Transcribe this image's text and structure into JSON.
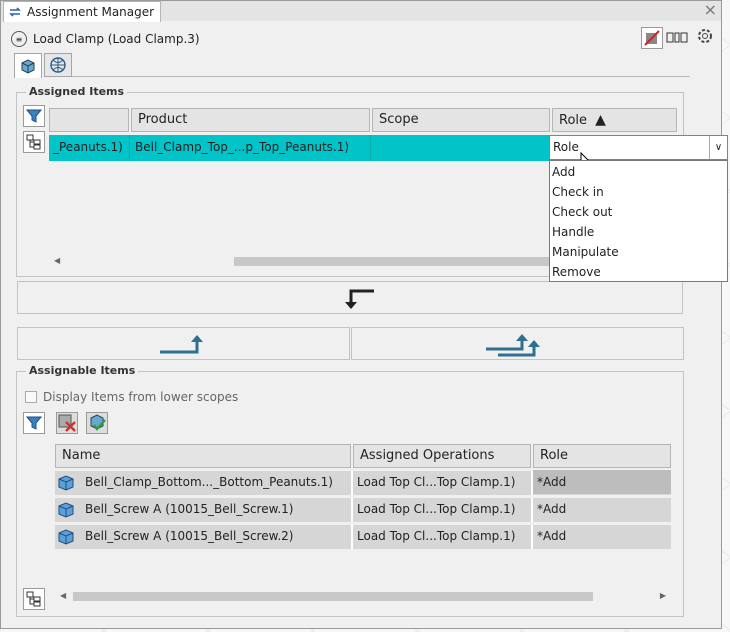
{
  "window": {
    "title": "Assignment Manager",
    "close_glyph": "×"
  },
  "context": {
    "label": "Load Clamp (Load Clamp.3)"
  },
  "assigned": {
    "legend": "Assigned Items",
    "columns": [
      "Product",
      "Scope",
      "Role"
    ],
    "row": {
      "prev_cell": "_Peanuts.1)",
      "product": "Bell_Clamp_Top_...p_Top_Peanuts.1)",
      "scope": "",
      "role": "Role"
    },
    "sort_glyph": "▲"
  },
  "role_dropdown": {
    "value": "Role",
    "options": [
      "Add",
      "Check in",
      "Check out",
      "Handle",
      "Manipulate",
      "Remove"
    ]
  },
  "assignable": {
    "legend": "Assignable Items",
    "checkbox_label": "Display Items from lower scopes",
    "columns": [
      "Name",
      "Assigned Operations",
      "Role"
    ],
    "rows": [
      {
        "name": "Bell_Clamp_Bottom..._Bottom_Peanuts.1)",
        "ops": "Load Top Cl...Top Clamp.1)",
        "role": "*Add"
      },
      {
        "name": "Bell_Screw A (10015_Bell_Screw.1)",
        "ops": "Load Top Cl...Top Clamp.1)",
        "role": "*Add"
      },
      {
        "name": "Bell_Screw A (10015_Bell_Screw.2)",
        "ops": "Load Top Cl...Top Clamp.1)",
        "role": "*Add"
      }
    ]
  },
  "colors": {
    "selection": "#00c4c8",
    "arrow_blue": "#2f6f8f"
  },
  "icons": [
    "assignment-manager-icon",
    "operation-icon",
    "remove-assignment-icon",
    "layout-icon",
    "settings-icon",
    "part-view-icon",
    "globe-icon",
    "filter-icon",
    "hierarchy-icon",
    "remove-filter-icon",
    "check-filter-icon",
    "part-icon"
  ]
}
